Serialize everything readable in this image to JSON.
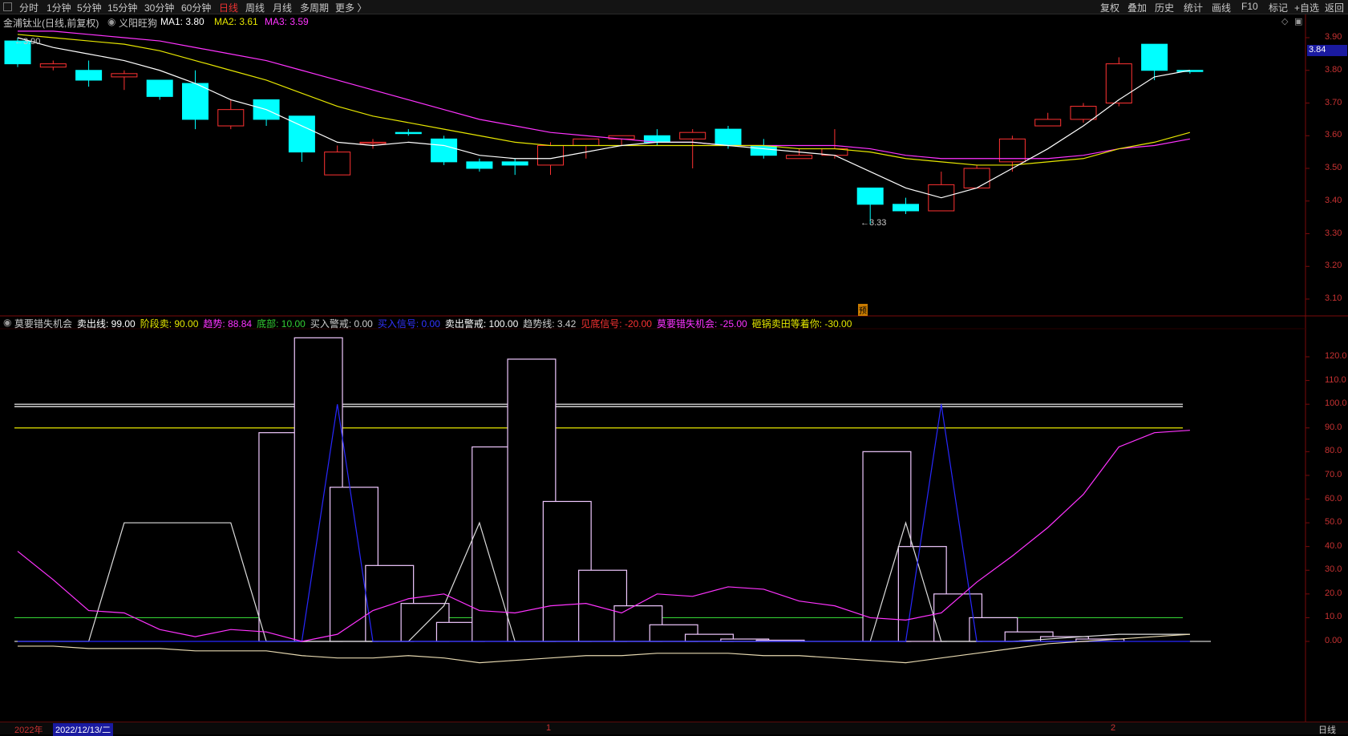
{
  "toolbar": {
    "periods": [
      "分时",
      "1分钟",
      "5分钟",
      "15分钟",
      "30分钟",
      "60分钟",
      "日线",
      "周线",
      "月线",
      "多周期",
      "更多 〉"
    ],
    "active_period": "日线",
    "right_items": [
      "复权",
      "叠加",
      "历史",
      "统计",
      "画线",
      "F10",
      "标记",
      "+自选",
      "返回"
    ]
  },
  "main_panel": {
    "stock_label": "金浦钛业(日线,前复权)",
    "strategy_label": "义阳旺狗",
    "ma1": "MA1: 3.80",
    "ma2": "MA2: 3.61",
    "ma3": "MA3: 3.59",
    "high_marker": "3.90",
    "low_marker": "3.33",
    "current_price": "3.84",
    "pre_marker": "预",
    "y_ticks": [
      "3.90",
      "3.80",
      "3.70",
      "3.60",
      "3.50",
      "3.40",
      "3.30",
      "3.20",
      "3.10"
    ]
  },
  "indicator_panel": {
    "name": "莫要错失机会",
    "fields": [
      {
        "label": "卖出线: 99.00",
        "color": "#ffffff"
      },
      {
        "label": "阶段卖: 90.00",
        "color": "#e6e600"
      },
      {
        "label": "趋势: 88.84",
        "color": "#ff33ff"
      },
      {
        "label": "底部: 10.00",
        "color": "#33cc33"
      },
      {
        "label": "买入警戒: 0.00",
        "color": "#cccccc"
      },
      {
        "label": "买入信号: 0.00",
        "color": "#3333ff"
      },
      {
        "label": "卖出警戒: 100.00",
        "color": "#ffffff"
      },
      {
        "label": "趋势线: 3.42",
        "color": "#cccccc"
      },
      {
        "label": "见底信号: -20.00",
        "color": "#ff3333"
      },
      {
        "label": "莫要错失机会: -25.00",
        "color": "#ff33ff"
      },
      {
        "label": "砸锅卖田等着你: -30.00",
        "color": "#e6e600"
      }
    ],
    "y_ticks": [
      "120.0",
      "110.0",
      "100.0",
      "90.0",
      "80.0",
      "70.0",
      "60.0",
      "50.0",
      "40.0",
      "30.0",
      "20.0",
      "10.0",
      "0.00"
    ]
  },
  "bottom_bar": {
    "year": "2022年",
    "date": "2022/12/13/二",
    "mark1": "1",
    "mark2": "2",
    "period": "日线"
  },
  "chart_data": {
    "type": "candlestick",
    "price_range": [
      3.05,
      3.95
    ],
    "candles": [
      {
        "o": 3.82,
        "h": 3.9,
        "l": 3.81,
        "c": 3.89,
        "up": false
      },
      {
        "o": 3.81,
        "h": 3.83,
        "l": 3.8,
        "c": 3.82,
        "up": true
      },
      {
        "o": 3.8,
        "h": 3.83,
        "l": 3.75,
        "c": 3.77,
        "up": false
      },
      {
        "o": 3.78,
        "h": 3.8,
        "l": 3.74,
        "c": 3.79,
        "up": true
      },
      {
        "o": 3.77,
        "h": 3.77,
        "l": 3.71,
        "c": 3.72,
        "up": false
      },
      {
        "o": 3.76,
        "h": 3.8,
        "l": 3.62,
        "c": 3.65,
        "up": false
      },
      {
        "o": 3.63,
        "h": 3.71,
        "l": 3.62,
        "c": 3.68,
        "up": true
      },
      {
        "o": 3.71,
        "h": 3.71,
        "l": 3.63,
        "c": 3.65,
        "up": false
      },
      {
        "o": 3.66,
        "h": 3.66,
        "l": 3.52,
        "c": 3.55,
        "up": false
      },
      {
        "o": 3.48,
        "h": 3.57,
        "l": 3.48,
        "c": 3.55,
        "up": true
      },
      {
        "o": 3.58,
        "h": 3.59,
        "l": 3.56,
        "c": 3.58,
        "up": true
      },
      {
        "o": 3.61,
        "h": 3.62,
        "l": 3.6,
        "c": 3.61,
        "up": false
      },
      {
        "o": 3.59,
        "h": 3.6,
        "l": 3.51,
        "c": 3.52,
        "up": false
      },
      {
        "o": 3.52,
        "h": 3.53,
        "l": 3.49,
        "c": 3.5,
        "up": false
      },
      {
        "o": 3.52,
        "h": 3.53,
        "l": 3.48,
        "c": 3.51,
        "up": false
      },
      {
        "o": 3.51,
        "h": 3.58,
        "l": 3.48,
        "c": 3.57,
        "up": true
      },
      {
        "o": 3.57,
        "h": 3.59,
        "l": 3.53,
        "c": 3.59,
        "up": true
      },
      {
        "o": 3.59,
        "h": 3.6,
        "l": 3.57,
        "c": 3.6,
        "up": true
      },
      {
        "o": 3.6,
        "h": 3.62,
        "l": 3.57,
        "c": 3.58,
        "up": false
      },
      {
        "o": 3.59,
        "h": 3.62,
        "l": 3.5,
        "c": 3.61,
        "up": true
      },
      {
        "o": 3.62,
        "h": 3.63,
        "l": 3.56,
        "c": 3.57,
        "up": false
      },
      {
        "o": 3.57,
        "h": 3.59,
        "l": 3.53,
        "c": 3.54,
        "up": false
      },
      {
        "o": 3.53,
        "h": 3.56,
        "l": 3.53,
        "c": 3.54,
        "up": true
      },
      {
        "o": 3.54,
        "h": 3.62,
        "l": 3.53,
        "c": 3.56,
        "up": true
      },
      {
        "o": 3.44,
        "h": 3.44,
        "l": 3.33,
        "c": 3.39,
        "up": false
      },
      {
        "o": 3.39,
        "h": 3.41,
        "l": 3.36,
        "c": 3.37,
        "up": false
      },
      {
        "o": 3.37,
        "h": 3.49,
        "l": 3.37,
        "c": 3.45,
        "up": true
      },
      {
        "o": 3.44,
        "h": 3.51,
        "l": 3.44,
        "c": 3.5,
        "up": true
      },
      {
        "o": 3.52,
        "h": 3.6,
        "l": 3.49,
        "c": 3.59,
        "up": true
      },
      {
        "o": 3.63,
        "h": 3.67,
        "l": 3.63,
        "c": 3.65,
        "up": true
      },
      {
        "o": 3.65,
        "h": 3.7,
        "l": 3.64,
        "c": 3.69,
        "up": true
      },
      {
        "o": 3.7,
        "h": 3.84,
        "l": 3.69,
        "c": 3.82,
        "up": true
      },
      {
        "o": 3.88,
        "h": 3.88,
        "l": 3.77,
        "c": 3.8,
        "up": false
      },
      {
        "o": 3.8,
        "h": 3.8,
        "l": 3.79,
        "c": 3.8,
        "up": false
      }
    ],
    "ma1": [
      3.9,
      3.87,
      3.85,
      3.83,
      3.8,
      3.76,
      3.71,
      3.68,
      3.63,
      3.58,
      3.57,
      3.58,
      3.57,
      3.54,
      3.53,
      3.53,
      3.55,
      3.57,
      3.58,
      3.58,
      3.57,
      3.56,
      3.55,
      3.54,
      3.49,
      3.44,
      3.41,
      3.44,
      3.5,
      3.56,
      3.63,
      3.71,
      3.78,
      3.8
    ],
    "ma2": [
      3.91,
      3.9,
      3.89,
      3.88,
      3.86,
      3.83,
      3.8,
      3.77,
      3.73,
      3.69,
      3.66,
      3.64,
      3.62,
      3.6,
      3.58,
      3.57,
      3.57,
      3.57,
      3.57,
      3.57,
      3.57,
      3.57,
      3.56,
      3.56,
      3.55,
      3.53,
      3.52,
      3.51,
      3.51,
      3.52,
      3.53,
      3.56,
      3.58,
      3.61
    ],
    "ma3": [
      3.92,
      3.92,
      3.91,
      3.9,
      3.89,
      3.87,
      3.85,
      3.83,
      3.8,
      3.77,
      3.74,
      3.71,
      3.68,
      3.65,
      3.63,
      3.61,
      3.6,
      3.59,
      3.58,
      3.58,
      3.57,
      3.57,
      3.57,
      3.57,
      3.56,
      3.54,
      3.53,
      3.53,
      3.53,
      3.53,
      3.54,
      3.56,
      3.57,
      3.59
    ],
    "indicator": {
      "range": [
        -8,
        130
      ],
      "boxes": [
        0,
        0,
        0,
        0,
        0,
        0,
        0,
        88,
        128,
        65,
        32,
        16,
        8,
        82,
        119,
        59,
        30,
        15,
        7,
        3,
        1,
        0.5,
        0,
        0,
        80,
        40,
        20,
        10,
        4,
        2,
        1,
        0,
        0,
        0
      ],
      "trend": [
        38,
        26,
        13,
        12,
        5,
        2,
        5,
        4,
        0,
        3,
        13,
        18,
        20,
        13,
        12,
        15,
        16,
        12,
        20,
        19,
        23,
        22,
        17,
        15,
        10,
        9,
        12,
        25,
        36,
        48,
        62,
        82,
        88,
        89
      ],
      "white_step": [
        0,
        0,
        0,
        50,
        50,
        50,
        50,
        0,
        0,
        0,
        0,
        0,
        15,
        50,
        0,
        0,
        0,
        0,
        0,
        0,
        0,
        0,
        0,
        0,
        0,
        50,
        0,
        0,
        0,
        1,
        2,
        3,
        3,
        3
      ],
      "blue": [
        0,
        0,
        0,
        0,
        0,
        0,
        0,
        0,
        0,
        100,
        0,
        0,
        0,
        0,
        0,
        0,
        0,
        0,
        0,
        0,
        0,
        0,
        0,
        0,
        0,
        0,
        100,
        0,
        0,
        0,
        0,
        0,
        0,
        0
      ],
      "trendline": [
        -2,
        -2,
        -3,
        -3,
        -3,
        -4,
        -4,
        -4,
        -6,
        -7,
        -7,
        -6,
        -7,
        -9,
        -8,
        -7,
        -6,
        -6,
        -5,
        -5,
        -5,
        -6,
        -6,
        -7,
        -8,
        -9,
        -7,
        -5,
        -3,
        -1,
        0,
        1,
        2,
        3
      ],
      "sell_line": 99,
      "stage_sell": 90,
      "bottom": 10,
      "sell_warn": 100
    }
  }
}
